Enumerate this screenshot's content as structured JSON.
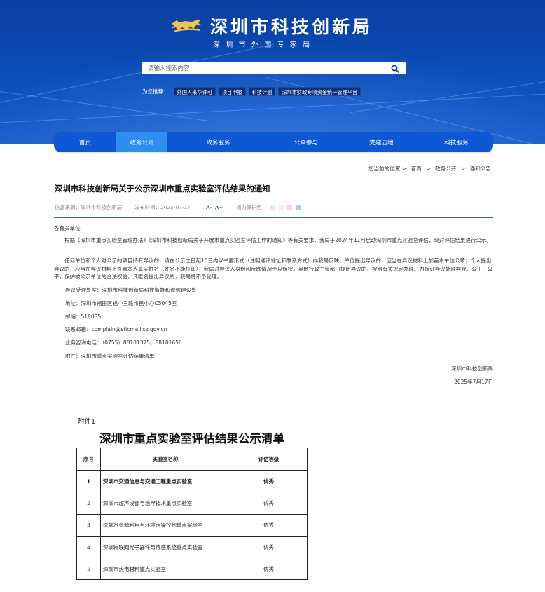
{
  "header": {
    "title": "深圳市科技创新局",
    "subtitle": "深圳市外国专家局",
    "search": {
      "placeholder": "请输入搜索内容"
    },
    "recommend_label": "为您推荐：",
    "recommend_tags": [
      "外国人来华许可",
      "项目申报",
      "科技计划",
      "深圳市财政专项资金统一管理平台"
    ],
    "logo_color": "#f2c14e"
  },
  "nav": {
    "items": [
      "首页",
      "政务公开",
      "政务服务",
      "公众参与",
      "党建园地",
      "科技服务"
    ],
    "active_index": 1,
    "bg_color": "#0f58d4",
    "active_color": "#2f8ff0"
  },
  "breadcrumb": {
    "prefix": "您当前的位置 >",
    "items": [
      "首页",
      "政务公开",
      "通知公告"
    ],
    "sep": ">"
  },
  "article": {
    "title": "深圳市科技创新局关于公示深圳市重点实验室评估结果的通知",
    "source": "信息来源：深圳市科技创新局",
    "publish_time": "发布时间：2025-07-17",
    "font_small": "A-",
    "font_large": "A+",
    "eye_label": "视力保护色：",
    "eye_colors": [
      "#cdeefb",
      "#f9f3c7",
      "#f7d2f2",
      "#a6cdf0"
    ],
    "salutation": "各有关单位:",
    "para1": "根据《深圳市重点实验室管理办法》《深圳市科技创新局关于开展市重点实验室评估工作的通知》等有关要求，我局于2024年11月启动深圳市重点实验室评估，现对评估结果进行公示。",
    "para2": "任何单位和个人对公示的项目持有异议的，请在公示之日起10日内以书面形式（注明通讯地址和联系方式）向我局反映。单位提出异议的，应当在异议材料上加盖本单位公章；个人提出异议的，应当在异议材料上签署本人真实姓名（姓名不能打印），我局对异议人身份和反映情况予以保密。其他行政主管部门提出异议的，按照有关规定办理。为保证异议处理客观、公正、公平，保护被公示单位的合法权益，凡匿名提出异议的，我局将不予受理。",
    "office": "异议受理处室：深圳市科技创新局科技监督和诚信建设处",
    "address": "地址：深圳市福田区福中三路市民中心C5045室",
    "postcode": "邮编：518035",
    "email": "联系邮箱：complain@sticmail.sz.gov.cn",
    "phone": "业务咨询电话：（0755）88101375、88101656",
    "attachment": "附件：深圳市重点实验室评估结果清单",
    "signer": "深圳市科技创新局",
    "date": "2025年7月17日"
  },
  "appendix": {
    "label": "附件1",
    "title": "深圳市重点实验室评估结果公示清单",
    "columns": [
      "序号",
      "实验室名称",
      "评估等级"
    ],
    "rows": [
      {
        "no": "1",
        "name": "深圳市交通信息与交通工程重点实验室",
        "grade": "优秀"
      },
      {
        "no": "2",
        "name": "深圳市超声成像与治疗技术重点实验室",
        "grade": "优秀"
      },
      {
        "no": "3",
        "name": "深圳水资源利用与环境污染控制重点实验室",
        "grade": "优秀"
      },
      {
        "no": "4",
        "name": "深圳物联网光子器件与传感系统重点实验室",
        "grade": "优秀"
      },
      {
        "no": "5",
        "name": "深圳市热电材料重点实验室",
        "grade": "优秀"
      }
    ]
  }
}
